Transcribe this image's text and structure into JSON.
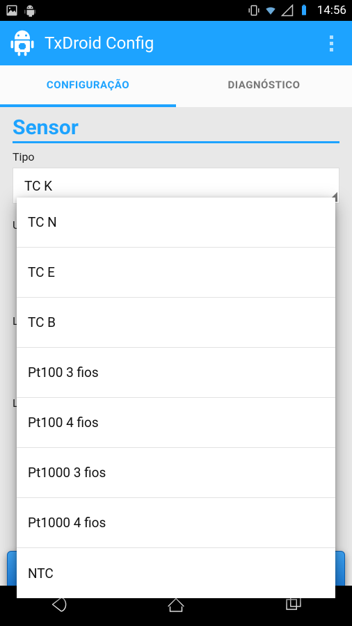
{
  "status": {
    "time": "14:56"
  },
  "app": {
    "title": "TxDroid Config"
  },
  "tabs": [
    {
      "label": "CONFIGURAÇÃO",
      "active": true
    },
    {
      "label": "DIAGNÓSTICO",
      "active": false
    }
  ],
  "section": {
    "title": "Sensor"
  },
  "field": {
    "type_label": "Tipo",
    "selected": "TC K"
  },
  "dropdown_options": [
    "TC N",
    "TC E",
    "TC B",
    "Pt100 3 fios",
    "Pt100 4 fios",
    "Pt1000 3 fios",
    "Pt1000 4 fios",
    "NTC"
  ],
  "bg": {
    "u": "U",
    "l": "L"
  }
}
